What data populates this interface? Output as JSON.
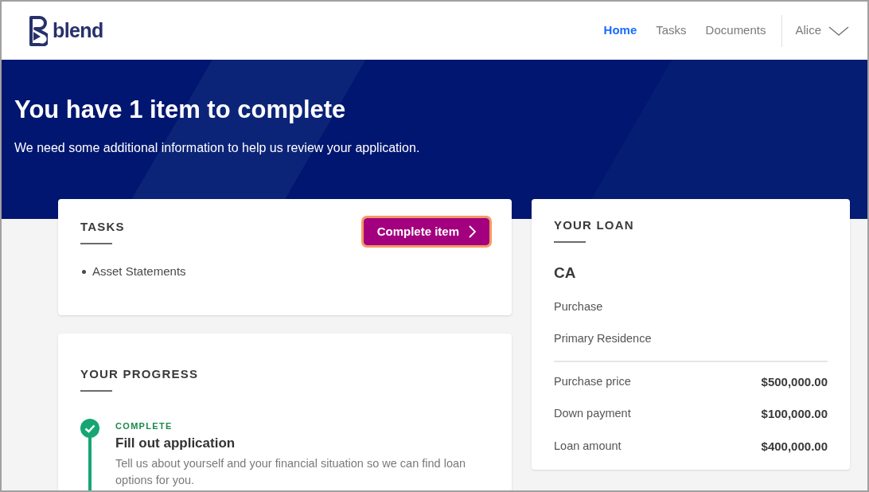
{
  "header": {
    "logo": "blend",
    "nav": [
      {
        "label": "Home",
        "selected": true
      },
      {
        "label": "Tasks",
        "selected": false
      },
      {
        "label": "Documents",
        "selected": false
      }
    ],
    "user": "Alice"
  },
  "hero": {
    "title": "You have 1 item to complete",
    "subtitle": "We need some additional information to help us review your application."
  },
  "tasks": {
    "title": "TASKS",
    "button": {
      "label": "Complete item",
      "focused": true
    },
    "items": [
      "Asset Statements"
    ]
  },
  "progress": {
    "title": "YOUR PROGRESS",
    "steps": [
      {
        "kind": "complete",
        "status_label": "COMPLETE",
        "title": "Fill out application",
        "description": "Tell us about yourself and your financial situation so we can find loan options for you."
      }
    ]
  },
  "loan": {
    "title": "YOUR LOAN",
    "state": "CA",
    "details": [
      "Purchase",
      "Primary Residence"
    ],
    "amounts": [
      {
        "label": "Purchase price",
        "value": "$500,000.00"
      },
      {
        "label": "Down payment",
        "value": "$100,000.00"
      },
      {
        "label": "Loan amount",
        "value": "$400,000.00"
      }
    ]
  }
}
